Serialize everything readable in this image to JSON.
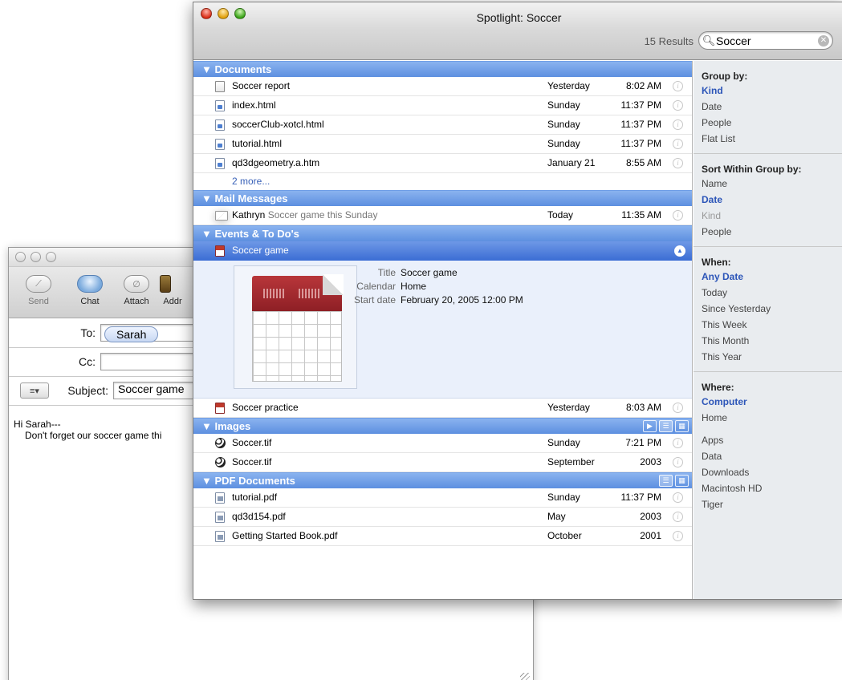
{
  "mail": {
    "toolbar": [
      {
        "label": "Send",
        "icon": "send-icon"
      },
      {
        "label": "Chat",
        "icon": "chat-icon"
      },
      {
        "label": "Attach",
        "icon": "paperclip-icon"
      },
      {
        "label": "Addr",
        "icon": "address-book-icon"
      }
    ],
    "to_label": "To:",
    "to_recipient": "Sarah",
    "cc_label": "Cc:",
    "subject_label": "Subject:",
    "subject_value": "Soccer game",
    "body_line1": "Hi Sarah---",
    "body_line2": "Don't forget our soccer game thi"
  },
  "spotlight": {
    "title": "Spotlight: Soccer",
    "results_count": "15 Results",
    "search_value": "Soccer",
    "sections": {
      "documents": {
        "title": "▼ Documents",
        "rows": [
          {
            "name": "Soccer report",
            "date": "Yesterday",
            "time": "8:02 AM"
          },
          {
            "name": "index.html",
            "date": "Sunday",
            "time": "11:37 PM"
          },
          {
            "name": "soccerClub-xotcl.html",
            "date": "Sunday",
            "time": "11:37 PM"
          },
          {
            "name": "tutorial.html",
            "date": "Sunday",
            "time": "11:37 PM"
          },
          {
            "name": "qd3dgeometry.a.htm",
            "date": "January 21",
            "time": "8:55 AM"
          }
        ],
        "more": "2 more..."
      },
      "mail": {
        "title": "▼ Mail Messages",
        "rows": [
          {
            "name": "Kathryn",
            "subject": "Soccer game this Sunday",
            "date": "Today",
            "time": "11:35 AM"
          }
        ]
      },
      "events": {
        "title": "▼ Events & To Do's",
        "selected": {
          "name": "Soccer game"
        },
        "preview": {
          "title_key": "Title",
          "title_val": "Soccer game",
          "calendar_key": "Calendar",
          "calendar_val": "Home",
          "start_key": "Start date",
          "start_val": "February 20, 2005 12:00 PM"
        },
        "rows": [
          {
            "name": "Soccer practice",
            "date": "Yesterday",
            "time": "8:03 AM"
          }
        ]
      },
      "images": {
        "title": "▼ Images",
        "rows": [
          {
            "name": "Soccer.tif",
            "date": "Sunday",
            "time": "7:21 PM"
          },
          {
            "name": "Soccer.tif",
            "date": "September",
            "time": "2003"
          }
        ]
      },
      "pdf": {
        "title": "▼ PDF Documents",
        "rows": [
          {
            "name": "tutorial.pdf",
            "date": "Sunday",
            "time": "11:37 PM"
          },
          {
            "name": "qd3d154.pdf",
            "date": "May",
            "time": "2003"
          },
          {
            "name": "Getting Started Book.pdf",
            "date": "October",
            "time": "2001"
          }
        ]
      }
    },
    "sidebar": {
      "group_by": {
        "header": "Group by:",
        "items": [
          "Kind",
          "Date",
          "People",
          "Flat List"
        ]
      },
      "sort_by": {
        "header": "Sort Within Group by:",
        "items": [
          "Name",
          "Date",
          "Kind",
          "People"
        ]
      },
      "when": {
        "header": "When:",
        "items": [
          "Any Date",
          "Today",
          "Since Yesterday",
          "This Week",
          "This Month",
          "This Year"
        ]
      },
      "where": {
        "header": "Where:",
        "items": [
          "Computer",
          "Home",
          "Apps",
          "Data",
          "Downloads",
          "Macintosh HD",
          "Tiger"
        ]
      }
    }
  }
}
